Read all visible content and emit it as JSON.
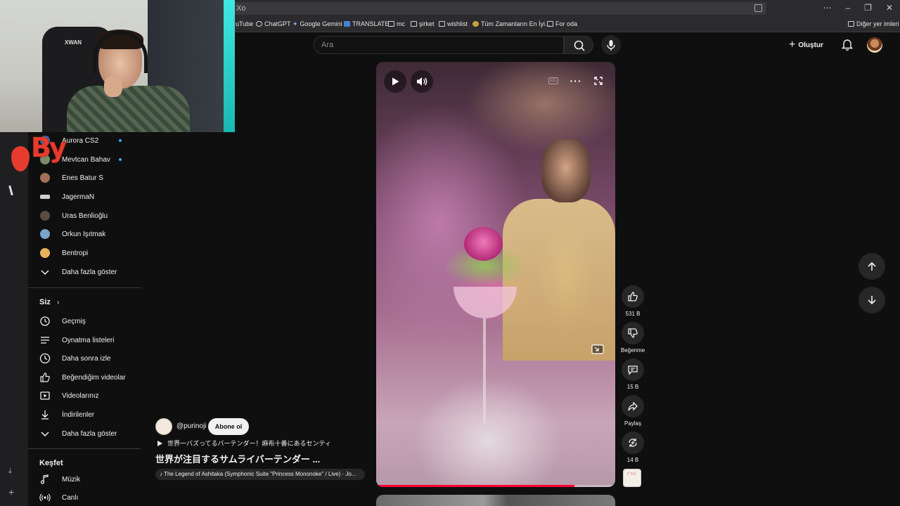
{
  "browser": {
    "url_text": "Xo",
    "bookmarks": [
      {
        "label": "uTube"
      },
      {
        "label": "ChatGPT"
      },
      {
        "label": "Google Gemini"
      },
      {
        "label": "TRANSLATE"
      },
      {
        "label": "mc"
      },
      {
        "label": "şirket"
      },
      {
        "label": "wishlist"
      },
      {
        "label": "Tüm Zamanların En İyi..."
      },
      {
        "label": "For oda"
      }
    ],
    "other_bookmarks": "Diğer yer imleri"
  },
  "header": {
    "search_placeholder": "Ara",
    "create_label": "Oluştur"
  },
  "sidebar": {
    "subscriptions": [
      {
        "label": "Aurora CS2",
        "new": true,
        "color": "#3b6db3"
      },
      {
        "label": "Mevtcan Bahav",
        "new": true,
        "color": "#7d8a6b"
      },
      {
        "label": "Enes Batur S",
        "new": false,
        "color": "#a36f5a"
      },
      {
        "label": "JagermaN",
        "new": false,
        "color": "#cfcfcf"
      },
      {
        "label": "Uras Benlioğlu",
        "new": false,
        "color": "#5b4a42"
      },
      {
        "label": "Orkun Işıtmak",
        "new": false,
        "color": "#7aa5c9"
      },
      {
        "label": "Bentropi",
        "new": false,
        "color": "#e7b35a"
      }
    ],
    "show_more_1": "Daha fazla göster",
    "you_section": "Siz",
    "you_items": [
      {
        "label": "Geçmiş",
        "icon": "history-icon"
      },
      {
        "label": "Oynatma listeleri",
        "icon": "playlists-icon"
      },
      {
        "label": "Daha sonra izle",
        "icon": "watch-later-icon"
      },
      {
        "label": "Beğendiğim videolar",
        "icon": "liked-videos-icon"
      },
      {
        "label": "Videolarınız",
        "icon": "your-videos-icon"
      },
      {
        "label": "İndirilenler",
        "icon": "downloads-icon"
      }
    ],
    "show_more_2": "Daha fazla göster",
    "explore_section": "Keşfet",
    "explore_items": [
      {
        "label": "Müzik",
        "icon": "music-icon"
      },
      {
        "label": "Canlı",
        "icon": "live-icon"
      }
    ]
  },
  "short": {
    "channel": "@purinoji",
    "subscribe_label": "Abone ol",
    "description": "世界一バズってるバーテンダー！麻布十番にあるセンティ",
    "title": "世界が注目するサムライバーテンダー ...",
    "sound": "The Legend of Ashitaka (Symphonic Suite \"Princess Mononoke\" / Live) · Jo...",
    "progress_percent": 83,
    "cc_label": "CC",
    "sound_thumb_text": "ﾌﾟﾘﾉｼﾞ"
  },
  "actions": {
    "likes": "531 B",
    "dislike_label": "Beğenme",
    "comments": "15 B",
    "share_label": "Paylaş",
    "remix": "14 B"
  },
  "overlay": {
    "streamer_logo_text": "By",
    "chair_brand": "XWAN"
  },
  "colors": {
    "background": "#0f0f0f",
    "progress": "#ff0033",
    "accent_dot": "#3ea6ff",
    "logo_red": "#e63b2e"
  }
}
